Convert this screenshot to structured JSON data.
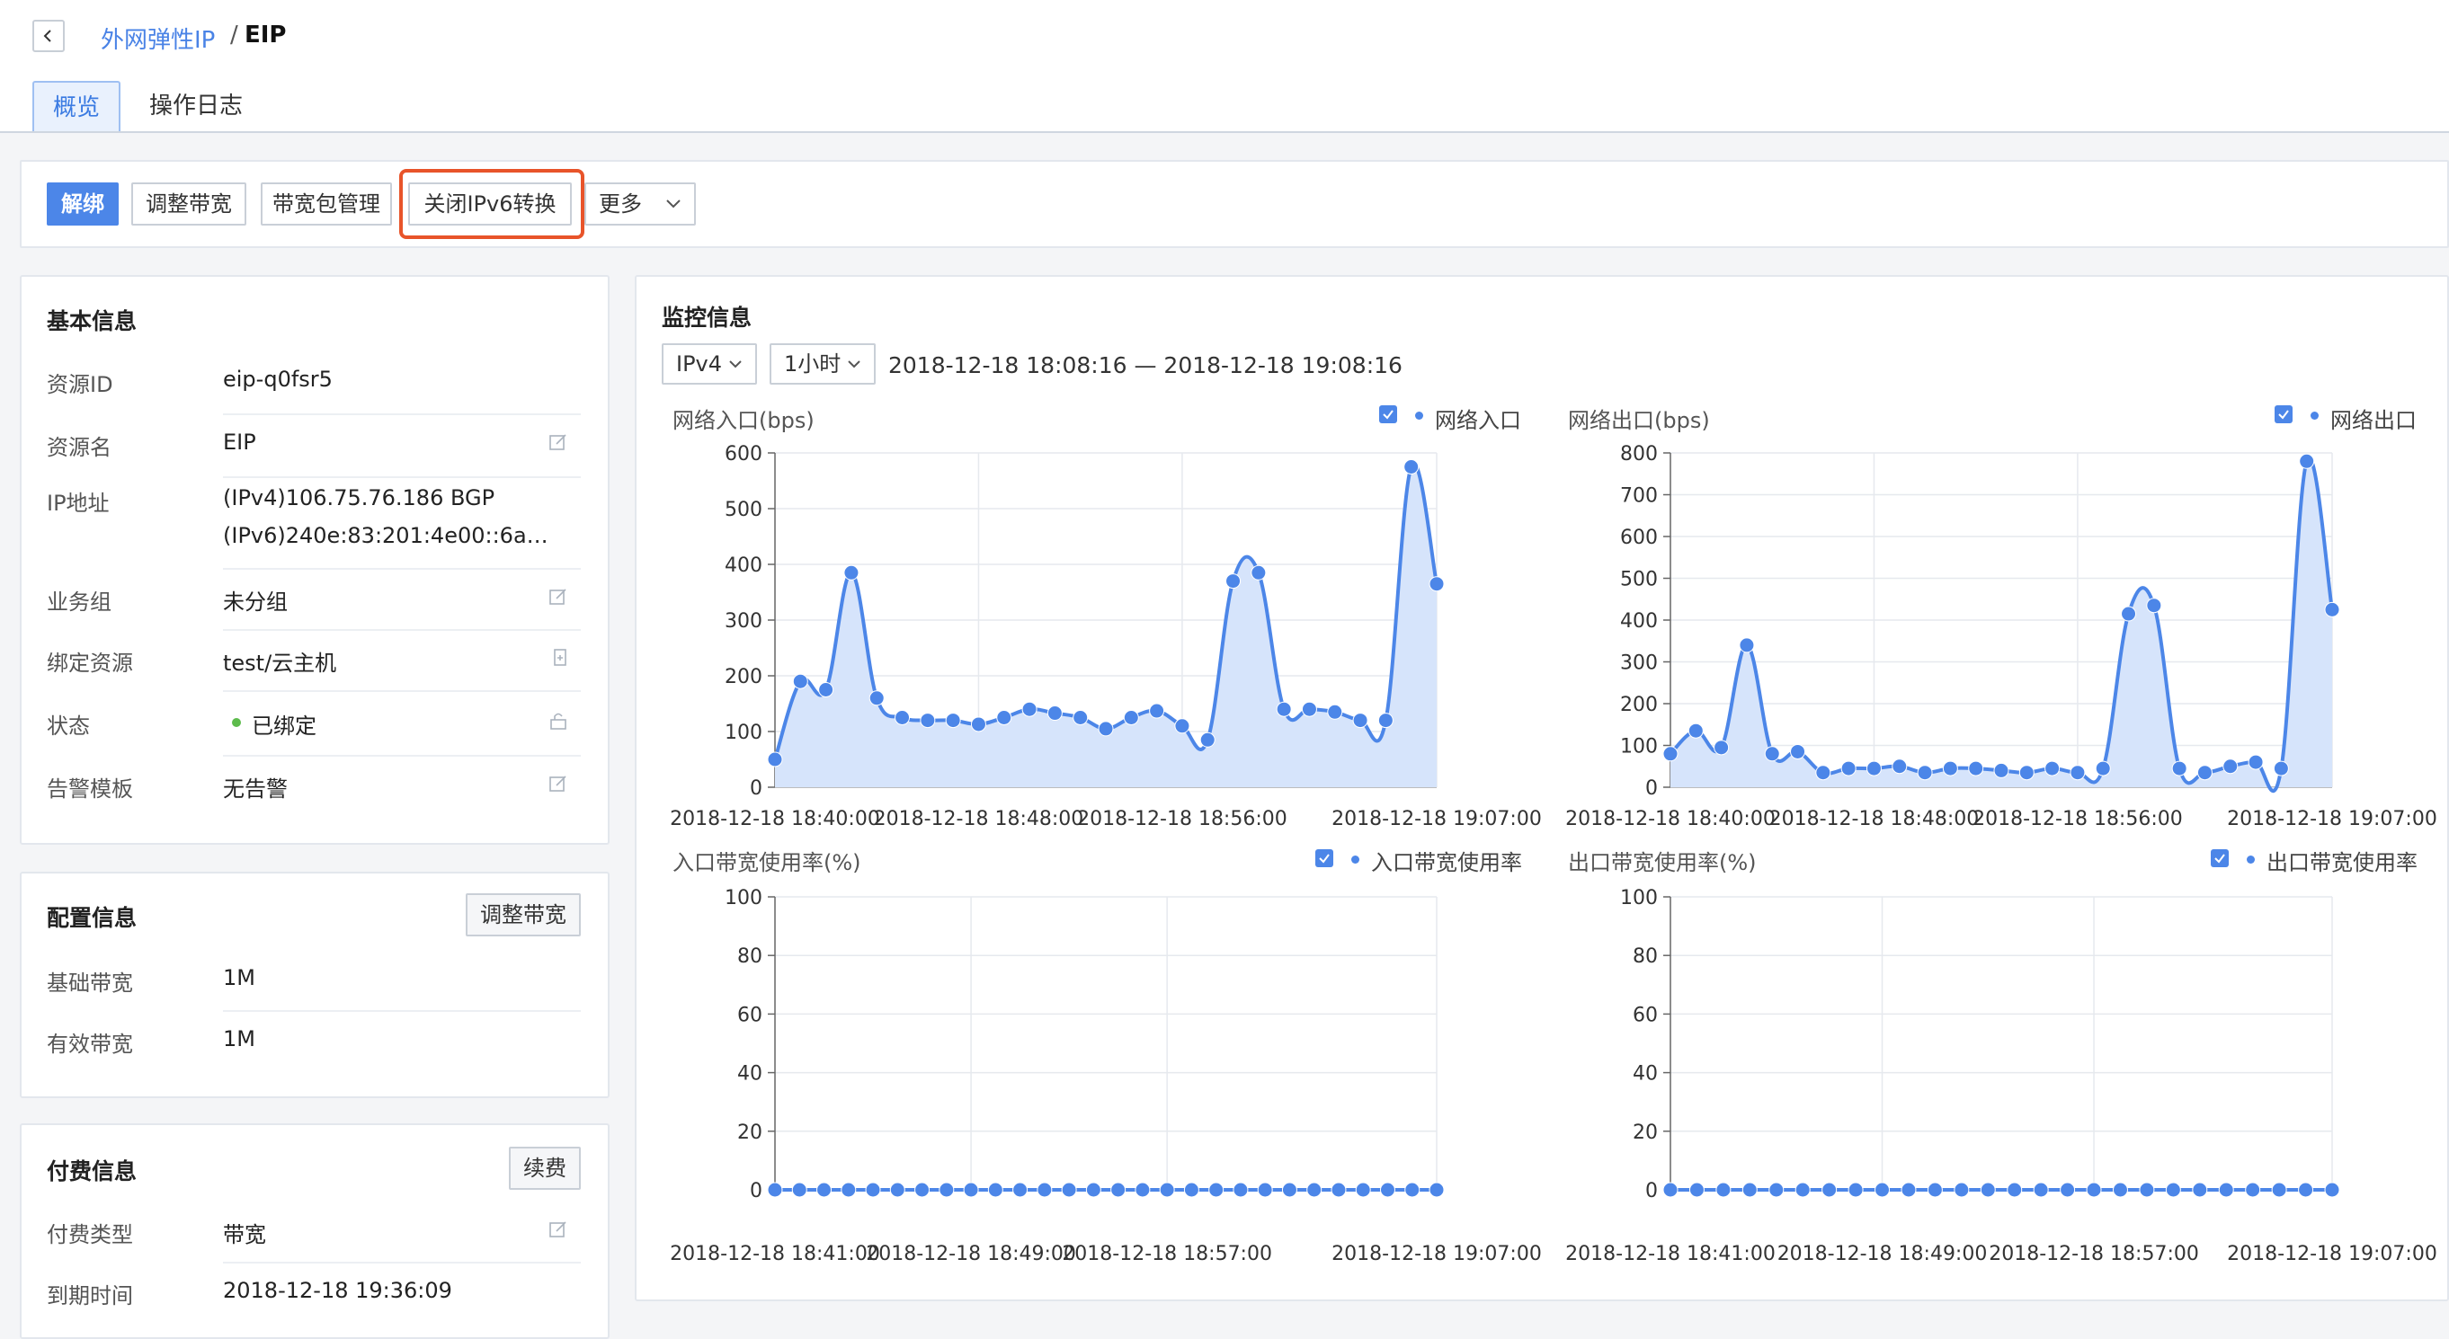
{
  "breadcrumb": {
    "parent": "外网弹性IP",
    "separator": "/",
    "current": "EIP"
  },
  "tabs": [
    "概览",
    "操作日志"
  ],
  "toolbar": {
    "unbind": "解绑",
    "adjust_bandwidth": "调整带宽",
    "bandwidth_package": "带宽包管理",
    "close_ipv6": "关闭IPv6转换",
    "more": "更多"
  },
  "basic_info": {
    "title": "基本信息",
    "rows": [
      {
        "label": "资源ID",
        "value": "eip-q0fsr5"
      },
      {
        "label": "资源名",
        "value": "EIP"
      },
      {
        "label": "IP地址",
        "value": "(IPv4)106.75.76.186 BGP",
        "value2": "(IPv6)240e:83:201:4e00::6a…"
      },
      {
        "label": "业务组",
        "value": "未分组"
      },
      {
        "label": "绑定资源",
        "value": "test/云主机"
      },
      {
        "label": "状态",
        "value": "已绑定"
      },
      {
        "label": "告警模板",
        "value": "无告警"
      }
    ]
  },
  "config_info": {
    "title": "配置信息",
    "button": "调整带宽",
    "rows": [
      {
        "label": "基础带宽",
        "value": "1M"
      },
      {
        "label": "有效带宽",
        "value": "1M"
      }
    ]
  },
  "billing_info": {
    "title": "付费信息",
    "button": "续费",
    "rows": [
      {
        "label": "付费类型",
        "value": "带宽"
      },
      {
        "label": "到期时间",
        "value": "2018-12-18 19:36:09"
      }
    ]
  },
  "monitor": {
    "title": "监控信息",
    "ip_select": "IPv4",
    "period_select": "1小时",
    "time_range": "2018-12-18 18:08:16 — 2018-12-18 19:08:16"
  },
  "colors": {
    "accent": "#4c86e8",
    "highlight": "#e8542a",
    "area_fill": "#d6e4fb",
    "status_green": "#5dbb4c"
  },
  "chart_data": [
    {
      "type": "area",
      "title": "网络入口(bps)",
      "series": [
        {
          "name": "网络入口",
          "values": [
            50,
            190,
            175,
            385,
            160,
            125,
            120,
            120,
            113,
            125,
            140,
            133,
            125,
            105,
            125,
            137,
            110,
            85,
            370,
            385,
            140,
            140,
            135,
            120,
            120,
            575,
            365
          ]
        }
      ],
      "x_ticks": [
        "2018-12-18 18:40:00",
        "2018-12-18 18:48:00",
        "2018-12-18 18:56:00",
        "2018-12-18 19:07:00"
      ],
      "x_tick_index": [
        0,
        8,
        16,
        26
      ],
      "ylim": [
        0,
        600
      ],
      "yticks": [
        0,
        100,
        200,
        300,
        400,
        500,
        600
      ]
    },
    {
      "type": "area",
      "title": "网络出口(bps)",
      "series": [
        {
          "name": "网络出口",
          "values": [
            80,
            135,
            95,
            340,
            80,
            85,
            35,
            45,
            45,
            50,
            35,
            45,
            45,
            40,
            35,
            45,
            35,
            45,
            415,
            435,
            45,
            35,
            50,
            60,
            45,
            780,
            425
          ]
        }
      ],
      "x_ticks": [
        "2018-12-18 18:40:00",
        "2018-12-18 18:48:00",
        "2018-12-18 18:56:00",
        "2018-12-18 19:07:00"
      ],
      "x_tick_index": [
        0,
        8,
        16,
        26
      ],
      "ylim": [
        0,
        800
      ],
      "yticks": [
        0,
        100,
        200,
        300,
        400,
        500,
        600,
        700,
        800
      ]
    },
    {
      "type": "line",
      "title": "入口带宽使用率(%)",
      "series": [
        {
          "name": "入口带宽使用率",
          "values": [
            0,
            0,
            0,
            0,
            0,
            0,
            0,
            0,
            0,
            0,
            0,
            0,
            0,
            0,
            0,
            0,
            0,
            0,
            0,
            0,
            0,
            0,
            0,
            0,
            0,
            0,
            0,
            0
          ]
        }
      ],
      "x_ticks": [
        "2018-12-18 18:41:00",
        "2018-12-18 18:49:00",
        "2018-12-18 18:57:00",
        "2018-12-18 19:07:00"
      ],
      "x_tick_index": [
        0,
        8,
        16,
        27
      ],
      "ylim": [
        0,
        100
      ],
      "yticks": [
        0,
        20,
        40,
        60,
        80,
        100
      ]
    },
    {
      "type": "line",
      "title": "出口带宽使用率(%)",
      "series": [
        {
          "name": "出口带宽使用率",
          "values": [
            0,
            0,
            0,
            0,
            0,
            0,
            0,
            0,
            0,
            0,
            0,
            0,
            0,
            0,
            0,
            0,
            0,
            0,
            0,
            0,
            0,
            0,
            0,
            0,
            0,
            0
          ]
        }
      ],
      "x_ticks": [
        "2018-12-18 18:41:00",
        "2018-12-18 18:49:00",
        "2018-12-18 18:57:00",
        "2018-12-18 19:07:00"
      ],
      "x_tick_index": [
        0,
        8,
        16,
        25
      ],
      "ylim": [
        0,
        100
      ],
      "yticks": [
        0,
        20,
        40,
        60,
        80,
        100
      ]
    }
  ]
}
